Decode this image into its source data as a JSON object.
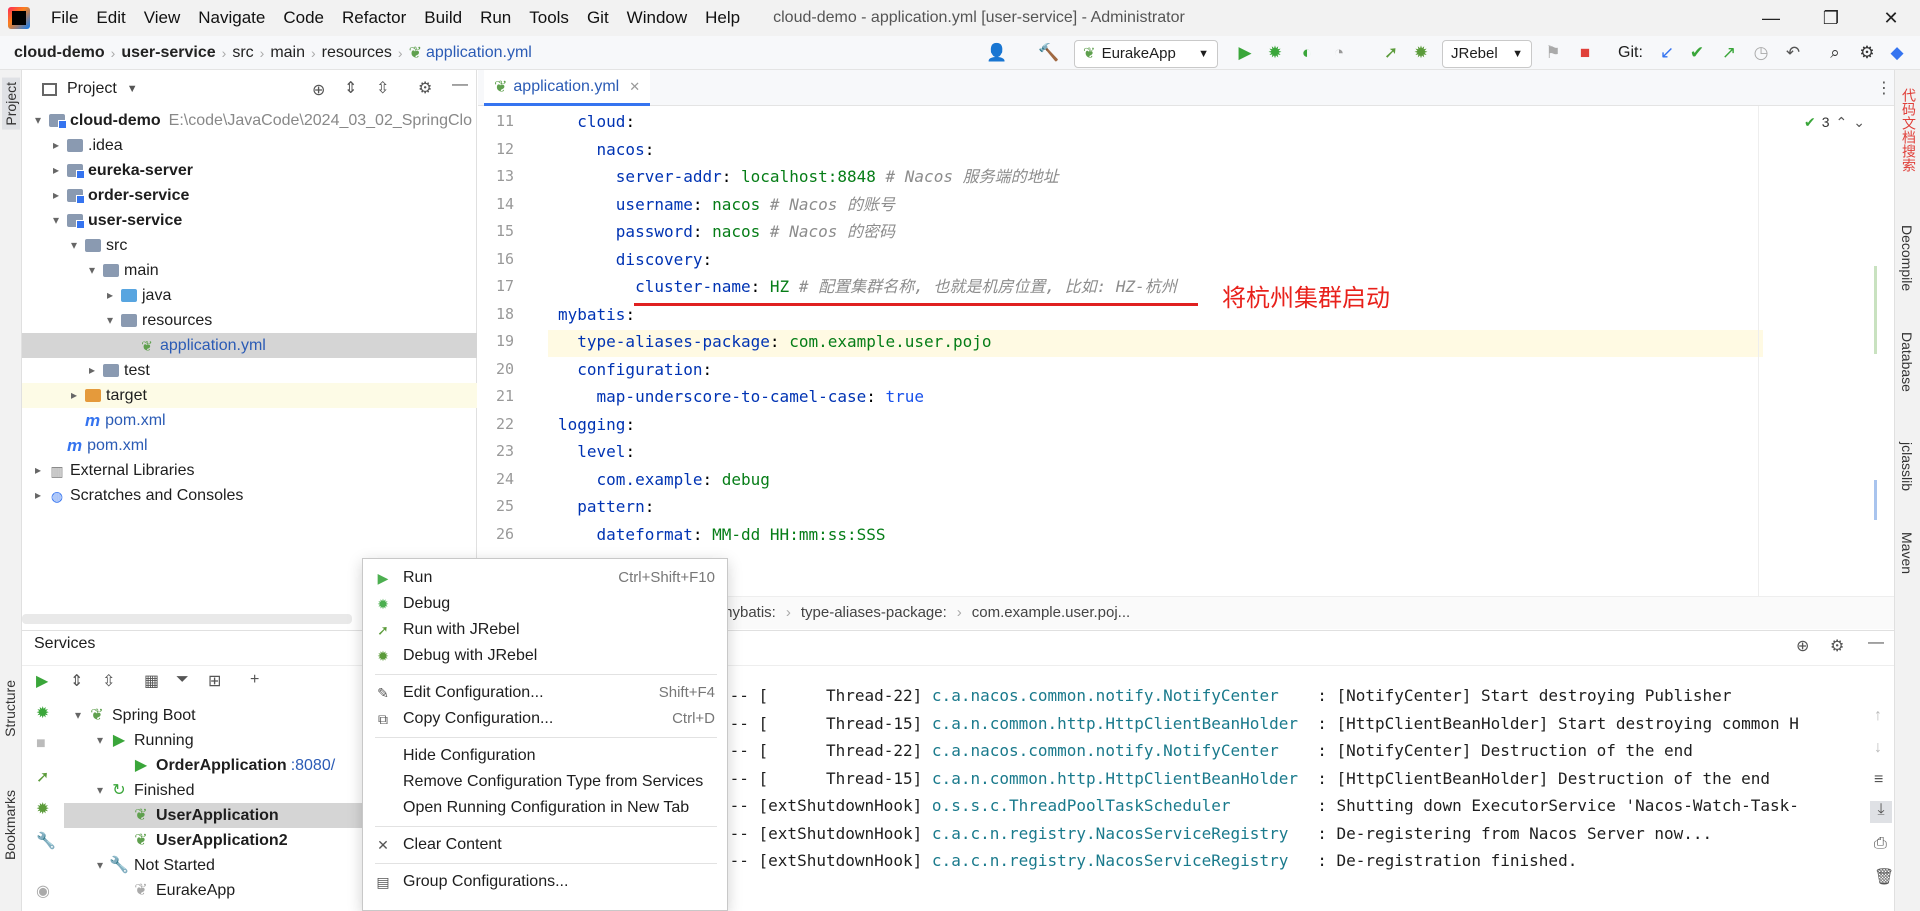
{
  "window": {
    "title": "cloud-demo - application.yml [user-service] - Administrator",
    "menu": [
      "File",
      "Edit",
      "View",
      "Navigate",
      "Code",
      "Refactor",
      "Build",
      "Run",
      "Tools",
      "Git",
      "Window",
      "Help"
    ],
    "minimize": "—",
    "maximize": "❐",
    "close": "✕"
  },
  "navbar": {
    "crumbs": [
      "cloud-demo",
      "user-service",
      "src",
      "main",
      "resources",
      "application.yml"
    ],
    "run_config": "EurakeApp",
    "jrebel": "JRebel",
    "git_label": "Git:"
  },
  "left_strip": {
    "project": "Project",
    "structure": "Structure",
    "bookmarks": "Bookmarks"
  },
  "right_strip": {
    "tool1": "代码文档搜索",
    "decompile": "Decompile",
    "database": "Database",
    "jclasslib": "jclasslib",
    "maven": "Maven"
  },
  "project": {
    "header": "Project",
    "tree": [
      {
        "label": "cloud-demo",
        "path": "E:\\code\\JavaCode\\2024_03_02_SpringClo",
        "indent": 0,
        "arrow": "▾",
        "type": "mod",
        "bold": true
      },
      {
        "label": ".idea",
        "indent": 1,
        "arrow": "▸",
        "type": "folder"
      },
      {
        "label": "eureka-server",
        "indent": 1,
        "arrow": "▸",
        "type": "mod",
        "bold": true
      },
      {
        "label": "order-service",
        "indent": 1,
        "arrow": "▸",
        "type": "mod",
        "bold": true
      },
      {
        "label": "user-service",
        "indent": 1,
        "arrow": "▾",
        "type": "mod",
        "bold": true
      },
      {
        "label": "src",
        "indent": 2,
        "arrow": "▾",
        "type": "folder"
      },
      {
        "label": "main",
        "indent": 3,
        "arrow": "▾",
        "type": "folder"
      },
      {
        "label": "java",
        "indent": 4,
        "arrow": "▸",
        "type": "blue"
      },
      {
        "label": "resources",
        "indent": 4,
        "arrow": "▾",
        "type": "folder"
      },
      {
        "label": "application.yml",
        "indent": 5,
        "arrow": "",
        "type": "leaf",
        "selected": true
      },
      {
        "label": "test",
        "indent": 3,
        "arrow": "▸",
        "type": "folder"
      },
      {
        "label": "target",
        "indent": 2,
        "arrow": "▸",
        "type": "orange",
        "highlight": true
      },
      {
        "label": "pom.xml",
        "indent": 2,
        "arrow": "",
        "type": "m"
      },
      {
        "label": "pom.xml",
        "indent": 1,
        "arrow": "",
        "type": "m"
      },
      {
        "label": "External Libraries",
        "indent": 0,
        "arrow": "▸",
        "type": "lib"
      },
      {
        "label": "Scratches and Consoles",
        "indent": 0,
        "arrow": "▸",
        "type": "scratch"
      }
    ]
  },
  "editor": {
    "tab": "application.yml",
    "inspection_count": "3",
    "lines": [
      {
        "n": "11",
        "html": [
          [
            "k",
            "  cloud"
          ],
          [
            "p",
            ":"
          ]
        ]
      },
      {
        "n": "12",
        "html": [
          [
            "k",
            "    nacos"
          ],
          [
            "p",
            ":"
          ]
        ]
      },
      {
        "n": "13",
        "html": [
          [
            "k",
            "      server-addr"
          ],
          [
            "p",
            ": "
          ],
          [
            "v",
            "localhost:8848"
          ],
          [
            "c",
            " # Nacos 服务端的地址"
          ]
        ]
      },
      {
        "n": "14",
        "html": [
          [
            "k",
            "      username"
          ],
          [
            "p",
            ": "
          ],
          [
            "v",
            "nacos"
          ],
          [
            "c",
            " # Nacos 的账号"
          ]
        ]
      },
      {
        "n": "15",
        "html": [
          [
            "k",
            "      password"
          ],
          [
            "p",
            ": "
          ],
          [
            "v",
            "nacos"
          ],
          [
            "c",
            " # Nacos 的密码"
          ]
        ]
      },
      {
        "n": "16",
        "html": [
          [
            "k",
            "      discovery"
          ],
          [
            "p",
            ":"
          ]
        ]
      },
      {
        "n": "17",
        "html": [
          [
            "k",
            "        cluster-name"
          ],
          [
            "p",
            ": "
          ],
          [
            "v",
            "HZ"
          ],
          [
            "c",
            " # 配置集群名称, 也就是机房位置, 比如: HZ-杭州"
          ]
        ]
      },
      {
        "n": "18",
        "html": [
          [
            "k",
            "mybatis"
          ],
          [
            "p",
            ":"
          ]
        ]
      },
      {
        "n": "19",
        "html": [
          [
            "k",
            "  type-aliases-package"
          ],
          [
            "p",
            ": "
          ],
          [
            "v",
            "com.example.user.pojo"
          ]
        ]
      },
      {
        "n": "20",
        "html": [
          [
            "k",
            "  configuration"
          ],
          [
            "p",
            ":"
          ]
        ]
      },
      {
        "n": "21",
        "html": [
          [
            "k",
            "    map-underscore-to-camel-case"
          ],
          [
            "p",
            ": "
          ],
          [
            "num",
            "true"
          ]
        ]
      },
      {
        "n": "22",
        "html": [
          [
            "k",
            "logging"
          ],
          [
            "p",
            ":"
          ]
        ]
      },
      {
        "n": "23",
        "html": [
          [
            "k",
            "  level"
          ],
          [
            "p",
            ":"
          ]
        ]
      },
      {
        "n": "24",
        "html": [
          [
            "k",
            "    com.example"
          ],
          [
            "p",
            ": "
          ],
          [
            "v",
            "debug"
          ]
        ]
      },
      {
        "n": "25",
        "html": [
          [
            "k",
            "  pattern"
          ],
          [
            "p",
            ":"
          ]
        ]
      },
      {
        "n": "26",
        "html": [
          [
            "k",
            "    dateformat"
          ],
          [
            "p",
            ": "
          ],
          [
            "v",
            "MM-dd HH:mm:ss:SSS"
          ]
        ]
      }
    ],
    "annotation": "将杭州集群启动",
    "breadcrumb": [
      "mybatis:",
      "type-aliases-package:",
      "com.example.user.poj..."
    ]
  },
  "services": {
    "title": "Services",
    "tree": [
      {
        "label": "Spring Boot",
        "indent": 0,
        "arrow": "▾",
        "icon": "spring"
      },
      {
        "label": "Running",
        "indent": 1,
        "arrow": "▾",
        "icon": "run"
      },
      {
        "label": "OrderApplication",
        "port": ":8080/",
        "indent": 2,
        "arrow": "",
        "icon": "run",
        "bold": true
      },
      {
        "label": "Finished",
        "indent": 1,
        "arrow": "▾",
        "icon": "refresh"
      },
      {
        "label": "UserApplication",
        "indent": 2,
        "arrow": "",
        "icon": "spring",
        "bold": true,
        "selected": true
      },
      {
        "label": "UserApplication2",
        "indent": 2,
        "arrow": "",
        "icon": "spring",
        "bold": true
      },
      {
        "label": "Not Started",
        "indent": 1,
        "arrow": "▾",
        "icon": "wrench"
      },
      {
        "label": "EurakeApp",
        "indent": 2,
        "arrow": "",
        "icon": "spring-gray"
      }
    ],
    "log": [
      {
        "pre": "--- [      Thread-22] ",
        "cls": "c.a.nacos.common.notify.NotifyCenter",
        "msg": "    : [NotifyCenter] Start destroying Publisher"
      },
      {
        "pre": "--- [      Thread-15] ",
        "cls": "c.a.n.common.http.HttpClientBeanHolder",
        "msg": "  : [HttpClientBeanHolder] Start destroying common H"
      },
      {
        "pre": "--- [      Thread-22] ",
        "cls": "c.a.nacos.common.notify.NotifyCenter",
        "msg": "    : [NotifyCenter] Destruction of the end"
      },
      {
        "pre": "--- [      Thread-15] ",
        "cls": "c.a.n.common.http.HttpClientBeanHolder",
        "msg": "  : [HttpClientBeanHolder] Destruction of the end"
      },
      {
        "pre": "--- [extShutdownHook] ",
        "cls": "o.s.s.c.ThreadPoolTaskScheduler",
        "msg": "         : Shutting down ExecutorService 'Nacos-Watch-Task-"
      },
      {
        "pre": "--- [extShutdownHook] ",
        "cls": "c.a.c.n.registry.NacosServiceRegistry",
        "msg": "   : De-registering from Nacos Server now..."
      },
      {
        "pre": "--- [extShutdownHook] ",
        "cls": "c.a.c.n.registry.NacosServiceRegistry",
        "msg": "   : De-registration finished."
      }
    ]
  },
  "context_menu": {
    "items": [
      {
        "label": "Run",
        "shortcut": "Ctrl+Shift+F10",
        "icon": "▶",
        "color": "#4caf50"
      },
      {
        "label": "Debug",
        "shortcut": "",
        "icon": "✹",
        "color": "#4caf50"
      },
      {
        "label": "Run with JRebel",
        "shortcut": "",
        "icon": "➚",
        "color": "#5b9b3a"
      },
      {
        "label": "Debug with JRebel",
        "shortcut": "",
        "icon": "✹",
        "color": "#5b9b3a"
      },
      {
        "sep": true
      },
      {
        "label": "Edit Configuration...",
        "shortcut": "Shift+F4",
        "icon": "✎",
        "color": "#555"
      },
      {
        "label": "Copy Configuration...",
        "shortcut": "Ctrl+D",
        "icon": "⧉",
        "color": "#555"
      },
      {
        "sep": true
      },
      {
        "label": "Hide Configuration",
        "shortcut": "",
        "icon": "",
        "color": "#555"
      },
      {
        "label": "Remove Configuration Type from Services",
        "shortcut": "",
        "icon": "",
        "color": "#555"
      },
      {
        "label": "Open Running Configuration in New Tab",
        "shortcut": "",
        "icon": "",
        "color": "#555"
      },
      {
        "sep": true
      },
      {
        "label": "Clear Content",
        "shortcut": "",
        "icon": "✕",
        "color": "#555"
      },
      {
        "sep": true
      },
      {
        "label": "Group Configurations...",
        "shortcut": "",
        "icon": "▤",
        "color": "#555"
      }
    ]
  }
}
